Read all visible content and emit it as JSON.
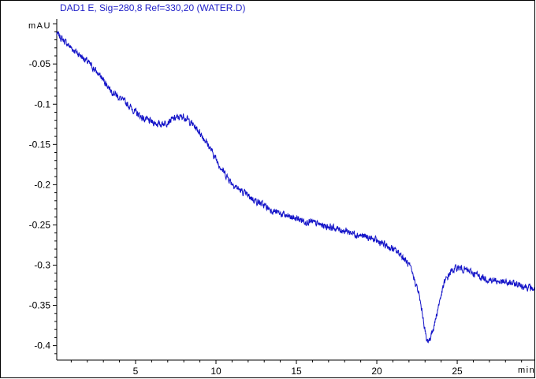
{
  "chart_data": {
    "type": "line",
    "title": "DAD1 E, Sig=280,8 Ref=330,20 (WATER.D)",
    "ylabel": "mAU",
    "xlabel": "min",
    "xlim": [
      0.1,
      29.8
    ],
    "ylim": [
      -0.418,
      0.006
    ],
    "x_ticks": [
      5,
      10,
      15,
      20,
      25
    ],
    "x_tick_labels": [
      "5",
      "10",
      "15",
      "20",
      "25"
    ],
    "y_ticks": [
      -0.05,
      -0.1,
      -0.15,
      -0.2,
      -0.25,
      -0.3,
      -0.35,
      -0.4
    ],
    "y_tick_labels": [
      "-0.05",
      "-0.1",
      "-0.15",
      "-0.2",
      "-0.25",
      "-0.3",
      "-0.35",
      "-0.4"
    ],
    "grid": false,
    "colors": {
      "series": "#1414c8",
      "title": "#1f1fc8",
      "axis": "#000000"
    },
    "series": [
      {
        "x": [
          0.1,
          0.5,
          1.0,
          1.5,
          2.0,
          2.5,
          3.0,
          3.5,
          4.0,
          4.5,
          5.0,
          5.5,
          6.0,
          6.5,
          7.0,
          7.5,
          8.0,
          8.5,
          9.0,
          9.5,
          10.0,
          10.5,
          11.0,
          11.5,
          12.0,
          12.5,
          13.0,
          13.5,
          14.0,
          14.5,
          15.0,
          15.5,
          16.0,
          16.5,
          17.0,
          17.5,
          18.0,
          18.5,
          19.0,
          19.5,
          20.0,
          20.5,
          21.0,
          21.5,
          22.0,
          22.3,
          22.6,
          22.9,
          23.1,
          23.3,
          23.6,
          23.9,
          24.2,
          24.6,
          25.0,
          25.4,
          26.0,
          26.5,
          27.0,
          27.5,
          28.0,
          28.5,
          29.0,
          29.5,
          29.8
        ],
        "values": [
          -0.012,
          -0.02,
          -0.03,
          -0.038,
          -0.047,
          -0.058,
          -0.07,
          -0.083,
          -0.092,
          -0.1,
          -0.11,
          -0.118,
          -0.122,
          -0.125,
          -0.122,
          -0.117,
          -0.115,
          -0.124,
          -0.135,
          -0.15,
          -0.168,
          -0.185,
          -0.198,
          -0.207,
          -0.214,
          -0.22,
          -0.226,
          -0.232,
          -0.236,
          -0.24,
          -0.242,
          -0.245,
          -0.247,
          -0.25,
          -0.252,
          -0.255,
          -0.257,
          -0.26,
          -0.263,
          -0.266,
          -0.27,
          -0.275,
          -0.28,
          -0.287,
          -0.3,
          -0.315,
          -0.335,
          -0.368,
          -0.395,
          -0.392,
          -0.372,
          -0.345,
          -0.322,
          -0.308,
          -0.303,
          -0.305,
          -0.31,
          -0.315,
          -0.318,
          -0.32,
          -0.322,
          -0.323,
          -0.325,
          -0.328,
          -0.33
        ],
        "noise_amplitude": 0.0045
      }
    ]
  }
}
